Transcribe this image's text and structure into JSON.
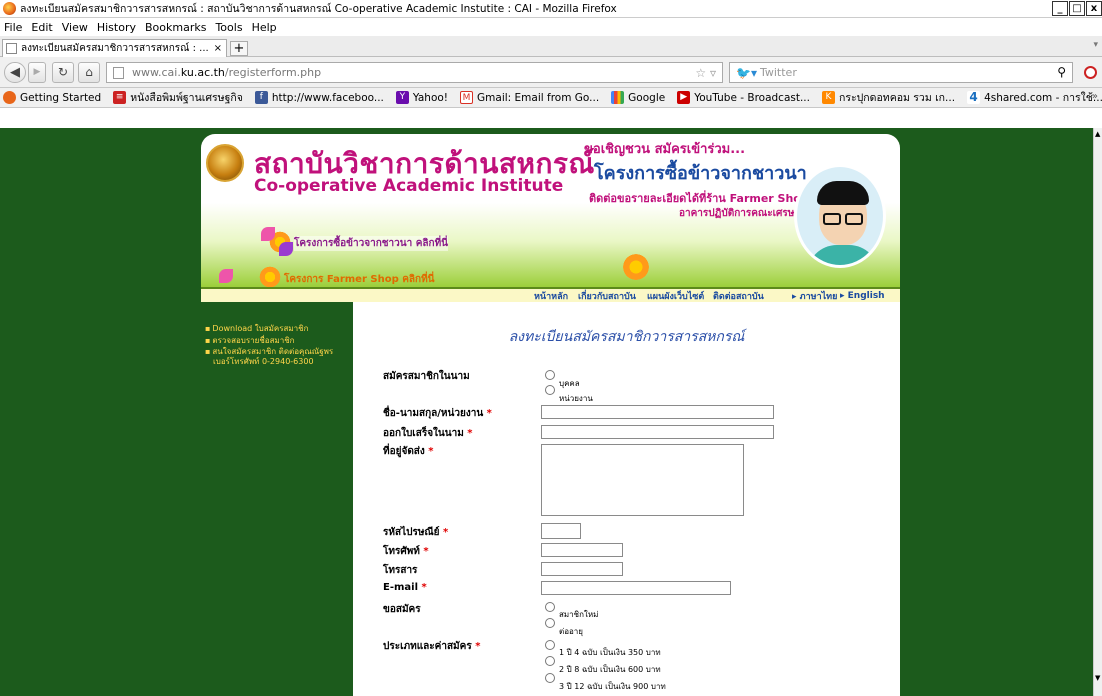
{
  "window": {
    "title": "ลงทะเบียนสมัครสมาชิกวารสารสหกรณ์ : สถาบันวิชาการด้านสหกรณ์ Co-operative Academic Instutite : CAI - Mozilla Firefox",
    "minimize": "_",
    "maximize": "□",
    "close": "x"
  },
  "menu": [
    "File",
    "Edit",
    "View",
    "History",
    "Bookmarks",
    "Tools",
    "Help"
  ],
  "tab": {
    "label": "ลงทะเบียนสมัครสมาชิกวารสารสหกรณ์ : ...",
    "close": "×",
    "new": "+"
  },
  "nav": {
    "url_prefix": "www.cai.",
    "url_domain": "ku.ac.th",
    "url_path": "/registerform.php",
    "search_placeholder": "Twitter"
  },
  "bookmarks": [
    {
      "label": "Getting Started",
      "icon": "firefox-icon",
      "color": "#e8661a"
    },
    {
      "label": "หนังสือพิมพ์ฐานเศรษฐกิจ",
      "icon": "newspaper-icon",
      "color": "#cc2222"
    },
    {
      "label": "http://www.faceboo...",
      "icon": "facebook-icon",
      "color": "#3b5998"
    },
    {
      "label": "Yahoo!",
      "icon": "yahoo-icon",
      "color": "#6a0dad"
    },
    {
      "label": "Gmail: Email from Go...",
      "icon": "gmail-icon",
      "color": "#d93025"
    },
    {
      "label": "Google",
      "icon": "google-icon",
      "color": "#4285f4"
    },
    {
      "label": "YouTube - Broadcast...",
      "icon": "youtube-icon",
      "color": "#cc0000"
    },
    {
      "label": "กระปุกดอทคอม รวม เก...",
      "icon": "kapook-icon",
      "color": "#ff8800"
    },
    {
      "label": "4shared.com - การใช้...",
      "icon": "4shared-icon",
      "color": "#1a6fc0"
    }
  ],
  "banner": {
    "thai_name": "สถาบันวิชาการด้านสหกรณ์",
    "eng_name": "Co-operative Academic Institute",
    "invite": "ขอเชิญชวน  สมัครเข้าร่วม...",
    "project": "โครงการซื้อข้าวจากชาวนา",
    "contact": "ติดต่อขอรายละเอียดได้ที่ร้าน Farmer Shop",
    "building": "อาคารปฏิบัติการคณะเศรษฐศาสตร์ มก.",
    "promo1": "โครงการซื้อข้าวจากชาวนา คลิกที่นี่",
    "promo2": "โครงการ Farmer Shop คลิกที่นี่"
  },
  "topnav": [
    "หน้าหลัก",
    "เกี่ยวกับสถาบัน",
    "แผนผังเว็บไซต์",
    "ติดต่อสถาบัน",
    "ภาษาไทย",
    "English"
  ],
  "sidebar": [
    "Download ใบสมัครสมาชิก",
    "ตรวจสอบรายชื่อสมาชิก",
    "สนใจสมัครสมาชิก ติดต่อคุณณัฐพร",
    "เบอร์โทรศัพท์ 0-2940-6300"
  ],
  "form": {
    "title": "ลงทะเบียนสมัครสมาชิกวารสารสหกรณ์",
    "apply_as": "สมัครสมาชิกในนาม",
    "apply_as_opts": [
      "บุคคล",
      "หน่วยงาน"
    ],
    "name": "ชื่อ-นามสกุล/หน่วยงาน",
    "receipt_name": "ออกใบเสร็จในนาม",
    "address": "ที่อยู่จัดส่ง",
    "postcode": "รหัสไปรษณีย์",
    "phone": "โทรศัพท์",
    "fax": "โทรสาร",
    "email": "E-mail",
    "request": "ขอสมัคร",
    "request_opts": [
      "สมาชิกใหม่",
      "ต่ออายุ"
    ],
    "type_fee": "ประเภทและค่าสมัคร",
    "fee_opts": [
      "1 ปี 4 ฉบับ เป็นเงิน 350 บาท",
      "2 ปี 8 ฉบับ เป็นเงิน 600 บาท",
      "3 ปี 12 ฉบับ เป็นเงิน 900 บาท"
    ],
    "required_mark": "*"
  }
}
